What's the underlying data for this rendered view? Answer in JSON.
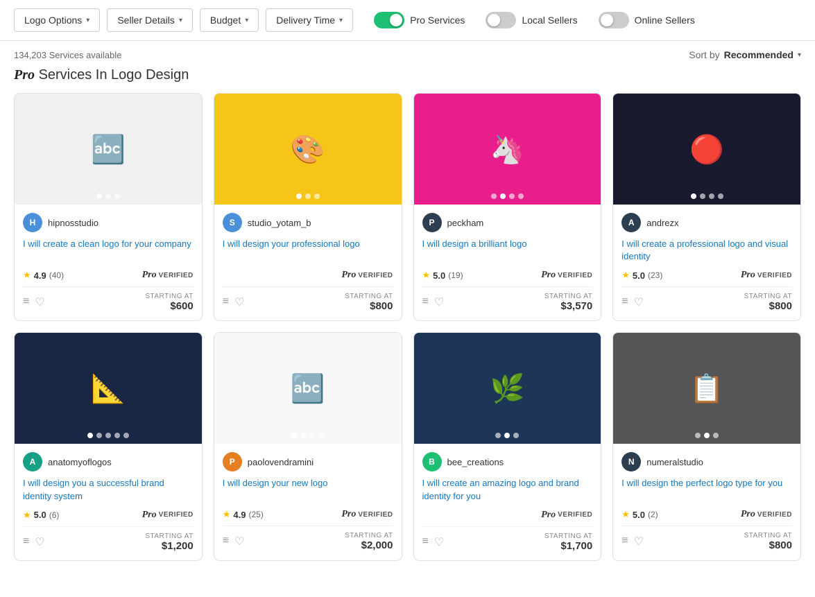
{
  "filters": {
    "logo_options": "Logo Options",
    "seller_details": "Seller Details",
    "budget": "Budget",
    "delivery_time": "Delivery Time",
    "pro_services_label": "Pro Services",
    "local_sellers_label": "Local Sellers",
    "online_sellers_label": "Online Sellers",
    "pro_services_on": true,
    "local_sellers_on": false,
    "online_sellers_on": false
  },
  "subheader": {
    "count": "134,203 Services available",
    "sort_prefix": "Sort by",
    "sort_value": "Recommended"
  },
  "page_title": "Services In Logo Design",
  "gigs": [
    {
      "id": 1,
      "seller": "hipnosstudio",
      "avatar_initials": "H",
      "avatar_class": "av-blue",
      "bg_class": "bg-gray",
      "title": "I will create a clean logo for your company",
      "rating": "4.9",
      "count": "(40)",
      "price": "$600",
      "dots": 3,
      "active_dot": 0,
      "emoji": "🔤"
    },
    {
      "id": 2,
      "seller": "studio_yotam_b",
      "avatar_initials": "S",
      "avatar_class": "av-blue",
      "bg_class": "bg-yellow",
      "title": "I will design your professional logo",
      "rating": "—",
      "count": "",
      "price": "$800",
      "dots": 3,
      "active_dot": 0,
      "emoji": "🎨"
    },
    {
      "id": 3,
      "seller": "peckham",
      "avatar_initials": "P",
      "avatar_class": "av-dark",
      "bg_class": "bg-pink",
      "title": "I will design a brilliant logo",
      "rating": "5.0",
      "count": "(19)",
      "price": "$3,570",
      "dots": 4,
      "active_dot": 1,
      "emoji": "🦄"
    },
    {
      "id": 4,
      "seller": "andrezx",
      "avatar_initials": "A",
      "avatar_class": "av-dark",
      "bg_class": "bg-dark",
      "title": "I will create a professional logo and visual identity",
      "rating": "5.0",
      "count": "(23)",
      "price": "$800",
      "dots": 4,
      "active_dot": 0,
      "emoji": "🔴"
    },
    {
      "id": 5,
      "seller": "anatomyoflogos",
      "avatar_initials": "A",
      "avatar_class": "av-teal",
      "bg_class": "bg-navy",
      "title": "I will design you a successful brand identity system",
      "rating": "5.0",
      "count": "(6)",
      "price": "$1,200",
      "dots": 5,
      "active_dot": 0,
      "emoji": "📐"
    },
    {
      "id": 6,
      "seller": "paolovendramini",
      "avatar_initials": "P",
      "avatar_class": "av-orange",
      "bg_class": "bg-white",
      "title": "I will design your new logo",
      "rating": "4.9",
      "count": "(25)",
      "price": "$2,000",
      "dots": 4,
      "active_dot": 0,
      "emoji": "🔤"
    },
    {
      "id": 7,
      "seller": "bee_creations",
      "avatar_initials": "B",
      "avatar_class": "av-green",
      "bg_class": "bg-blue2",
      "title": "I will create an amazing logo and brand identity for you",
      "rating": "—",
      "count": "",
      "price": "$1,700",
      "dots": 3,
      "active_dot": 1,
      "emoji": "🌿"
    },
    {
      "id": 8,
      "seller": "numeralstudio",
      "avatar_initials": "N",
      "avatar_class": "av-dark",
      "bg_class": "bg-gray2",
      "title": "I will design the perfect logo type for you",
      "rating": "5.0",
      "count": "(2)",
      "price": "$800",
      "dots": 3,
      "active_dot": 1,
      "emoji": "📋"
    }
  ],
  "labels": {
    "starting_at": "STARTING AT",
    "pro_verified": "VERIFIED",
    "list_icon": "≡",
    "heart_icon": "♡",
    "chevron": "▾"
  }
}
